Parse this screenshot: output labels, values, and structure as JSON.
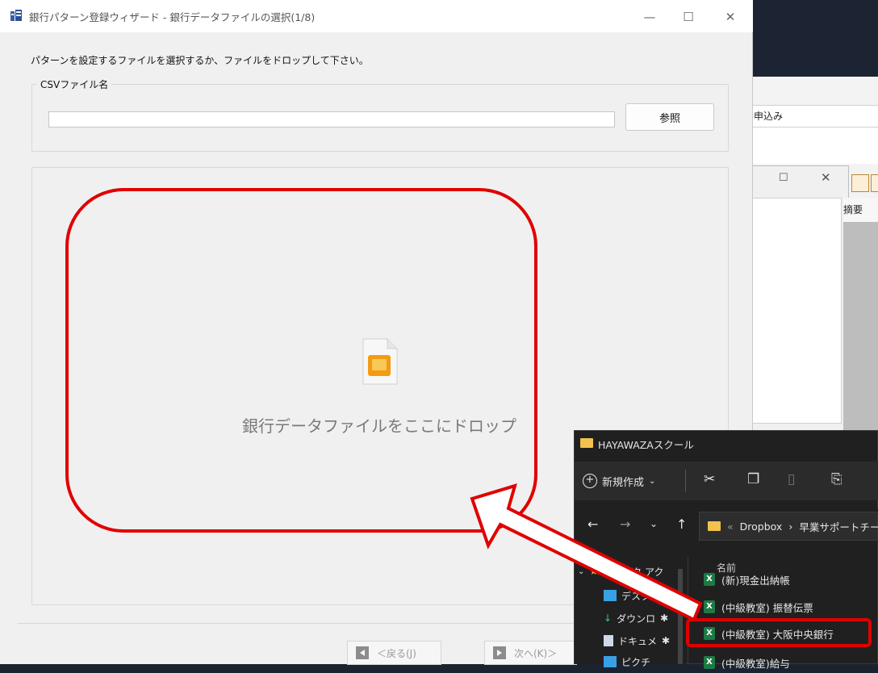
{
  "wizard": {
    "title": "銀行パターン登録ウィザード - 銀行データファイルの選択(1/8)",
    "instruction": "パターンを設定するファイルを選択するか、ファイルをドロップして下さい。",
    "csv_group_label": "CSVファイル名",
    "csv_value": "",
    "browse_label": "参照",
    "drop_hint": "銀行データファイルをここにドロップ",
    "back_label": "＜戻る(J)",
    "next_label": "次へ(K)＞",
    "minimize_icon": "—",
    "maximize_icon": "☐",
    "close_icon": "✕"
  },
  "background_app": {
    "menu_item": "お申込み",
    "grid_header": "摘要"
  },
  "explorer": {
    "title": "HAYAWAZAスクール",
    "new_label": "新規作成",
    "path_root": "Dropbox",
    "path_sep": "›",
    "path_next": "早業サポートチー",
    "column_name": "名前",
    "nav": [
      "クイック アク",
      "デスクト",
      "ダウンロ",
      "ドキュメ",
      "ピクチ"
    ],
    "files": [
      {
        "name": "(新)現金出納帳",
        "icon": "X"
      },
      {
        "name": "(中級教室) 振替伝票",
        "icon": "X"
      },
      {
        "name": "(中級教室) 大阪中央銀行",
        "icon": "X"
      },
      {
        "name": "(中級教室)給与",
        "icon": "X"
      }
    ]
  },
  "colors": {
    "highlight": "#e00000",
    "excel": "#1d7a45",
    "folder": "#f2c14e"
  }
}
